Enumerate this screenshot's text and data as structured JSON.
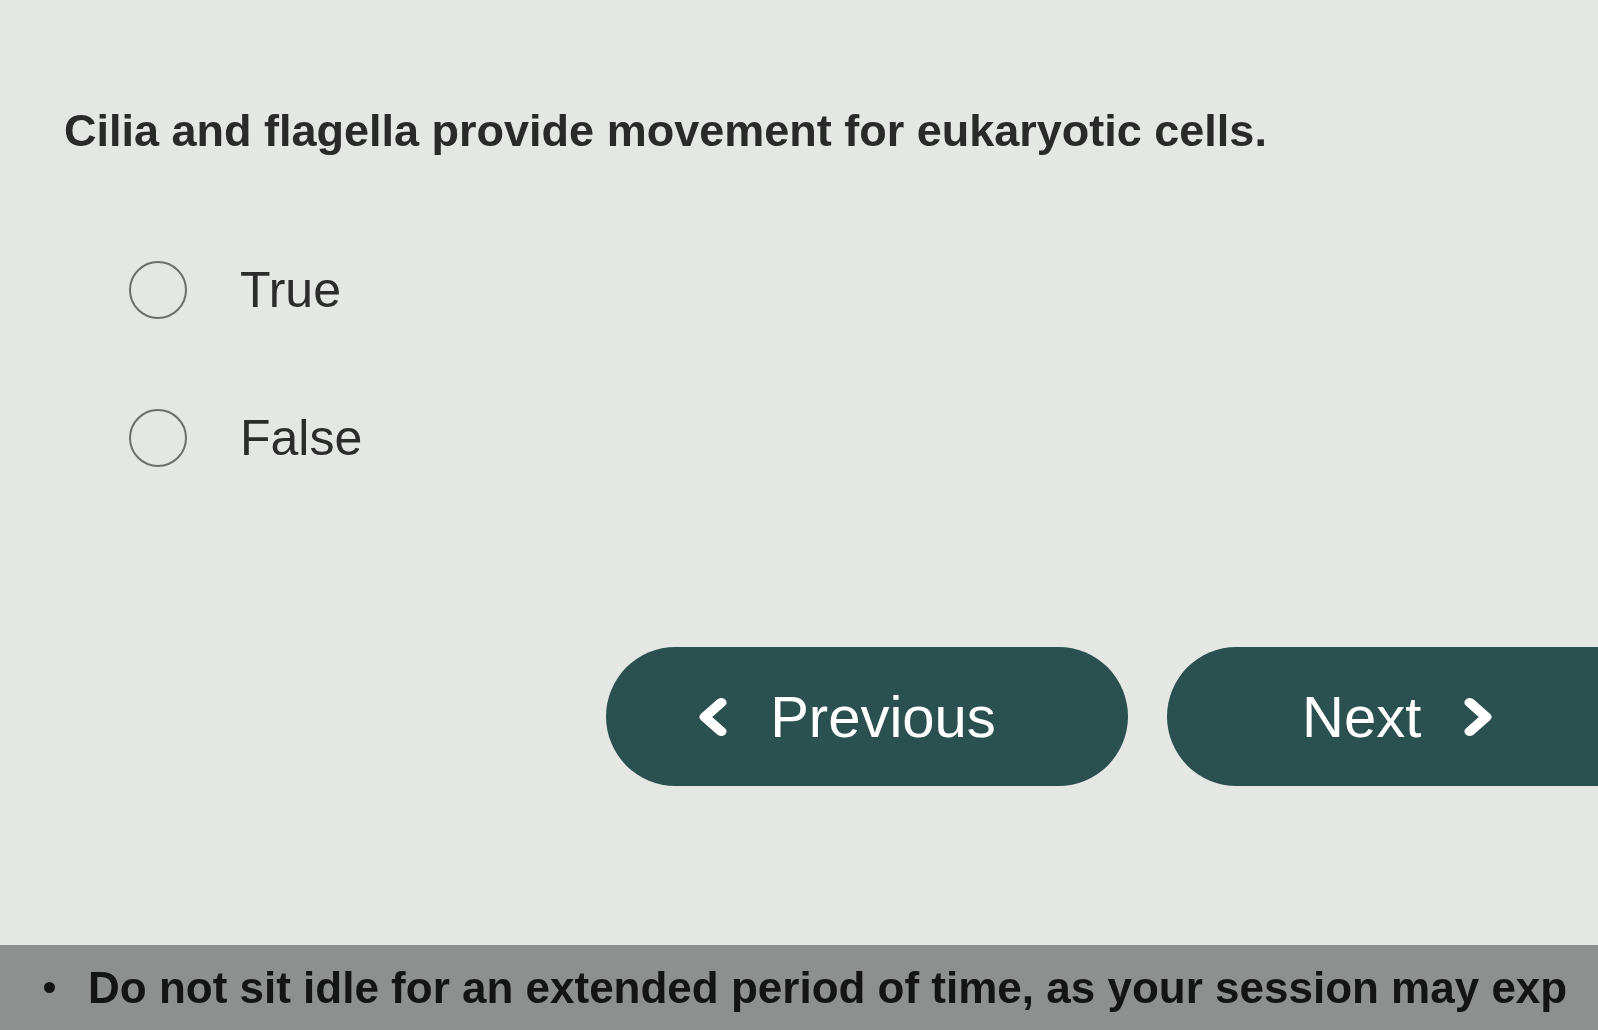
{
  "question": {
    "text": "Cilia and flagella provide movement for eukaryotic cells.",
    "options": [
      {
        "label": "True",
        "selected": false
      },
      {
        "label": "False",
        "selected": false
      }
    ]
  },
  "navigation": [
    {
      "kind": "previous",
      "label": "Previous"
    },
    {
      "kind": "next",
      "label": "Next"
    }
  ],
  "notice": {
    "items": [
      "Do not sit idle for an extended period of time, as your session may exp"
    ]
  }
}
